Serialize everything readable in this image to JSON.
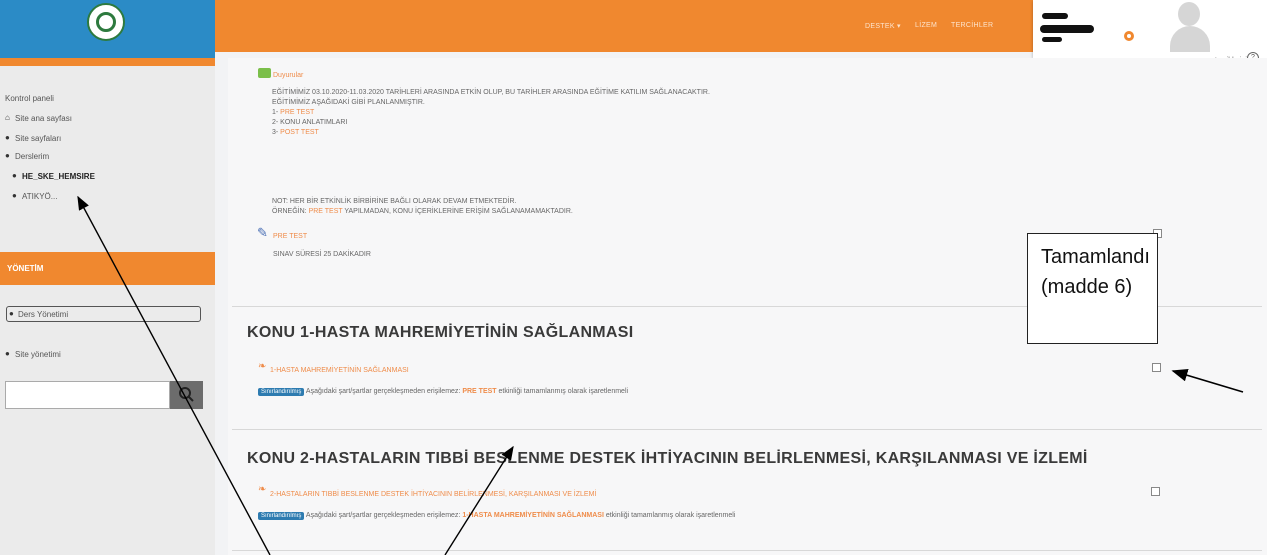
{
  "header": {
    "nav_items": [
      "DESTEK ▾",
      "LİZEM",
      "TERCİHLER"
    ],
    "user_hint": "tercihleriniz",
    "help_glyph": "?"
  },
  "sidebar": {
    "items": [
      {
        "label": "Kontrol paneli",
        "icon": ""
      },
      {
        "label": "Site ana sayfası",
        "icon": "home-icon"
      },
      {
        "label": "Site sayfaları",
        "icon": "chevron-right-icon"
      },
      {
        "label": "Derslerim",
        "icon": "chevron-down-icon"
      },
      {
        "label": "HE_SKE_HEMSIRE",
        "icon": "chevron-right-icon"
      },
      {
        "label": "ATIKYÖ...",
        "icon": "chevron-right-icon"
      }
    ],
    "admin_title": "YÖNETİM",
    "admin_items": [
      "Ders Yönetimi",
      "Site yönetimi"
    ],
    "search_placeholder": ""
  },
  "announcements": {
    "title": "Duyurular",
    "lines": [
      "EĞİTİMİMİZ 03.10.2020-11.03.2020 TARİHLERİ ARASINDA ETKİN OLUP, BU TARİHLER ARASINDA EĞİTİME KATILIM SAĞLANACAKTIR.",
      "EĞİTİMİMİZ AŞAĞIDAKİ GİBİ PLANLANMIŞTIR.",
      "1- ",
      "PRE TEST",
      "2- KONU ANLATIMLARI",
      "3- ",
      "POST TEST",
      "NOT: HER BİR ETKİNLİK BİRBİRİNE BAĞLI OLARAK DEVAM ETMEKTEDİR.",
      "ÖRNEĞİN: ",
      "PRE TEST",
      " YAPILMADAN, KONU İÇERİKLERİNE ERİŞİM SAĞLANAMAMAKTADIR."
    ],
    "pretest_label": "PRE TEST",
    "pretest_note": "SINAV SÜRESİ 25 DAKİKADIR"
  },
  "sections": [
    {
      "title": "KONU 1-HASTA MAHREMİYETİNİN SAĞLANMASI",
      "activity": "1-HASTA MAHREMİYETİNİN SAĞLANMASI",
      "badge": "Sınırlandırılmış",
      "restriction_pre": "Aşağıdaki şart/şartlar gerçekleşmeden erişilemez: ",
      "restriction_link": "PRE TEST",
      "restriction_post": " etkinliği tamamlanmış olarak işaretlenmeli"
    },
    {
      "title": "KONU 2-HASTALARIN TIBBİ BESLENME DESTEK İHTİYACININ BELİRLENMESİ, KARŞILANMASI VE İZLEMİ",
      "activity": "2-HASTALARIN TIBBİ BESLENME DESTEK İHTİYACININ BELİRLENMESİ, KARŞILANMASI VE İZLEMİ",
      "badge": "Sınırlandırılmış",
      "restriction_pre": "Aşağıdaki şart/şartlar gerçekleşmeden erişilemez: ",
      "restriction_link": "1-HASTA MAHREMİYETİNİN SAĞLANMASI",
      "restriction_post": " etkinliği tamamlanmış olarak işaretlenmeli"
    }
  ],
  "callout": {
    "line1": "Tamamlandı",
    "line2": "(madde 6)"
  },
  "colors": {
    "accent": "#f0882f",
    "logo_blue": "#2b8bc6",
    "badge_blue": "#2d7bb0",
    "link_orange": "#ef8c4a"
  }
}
